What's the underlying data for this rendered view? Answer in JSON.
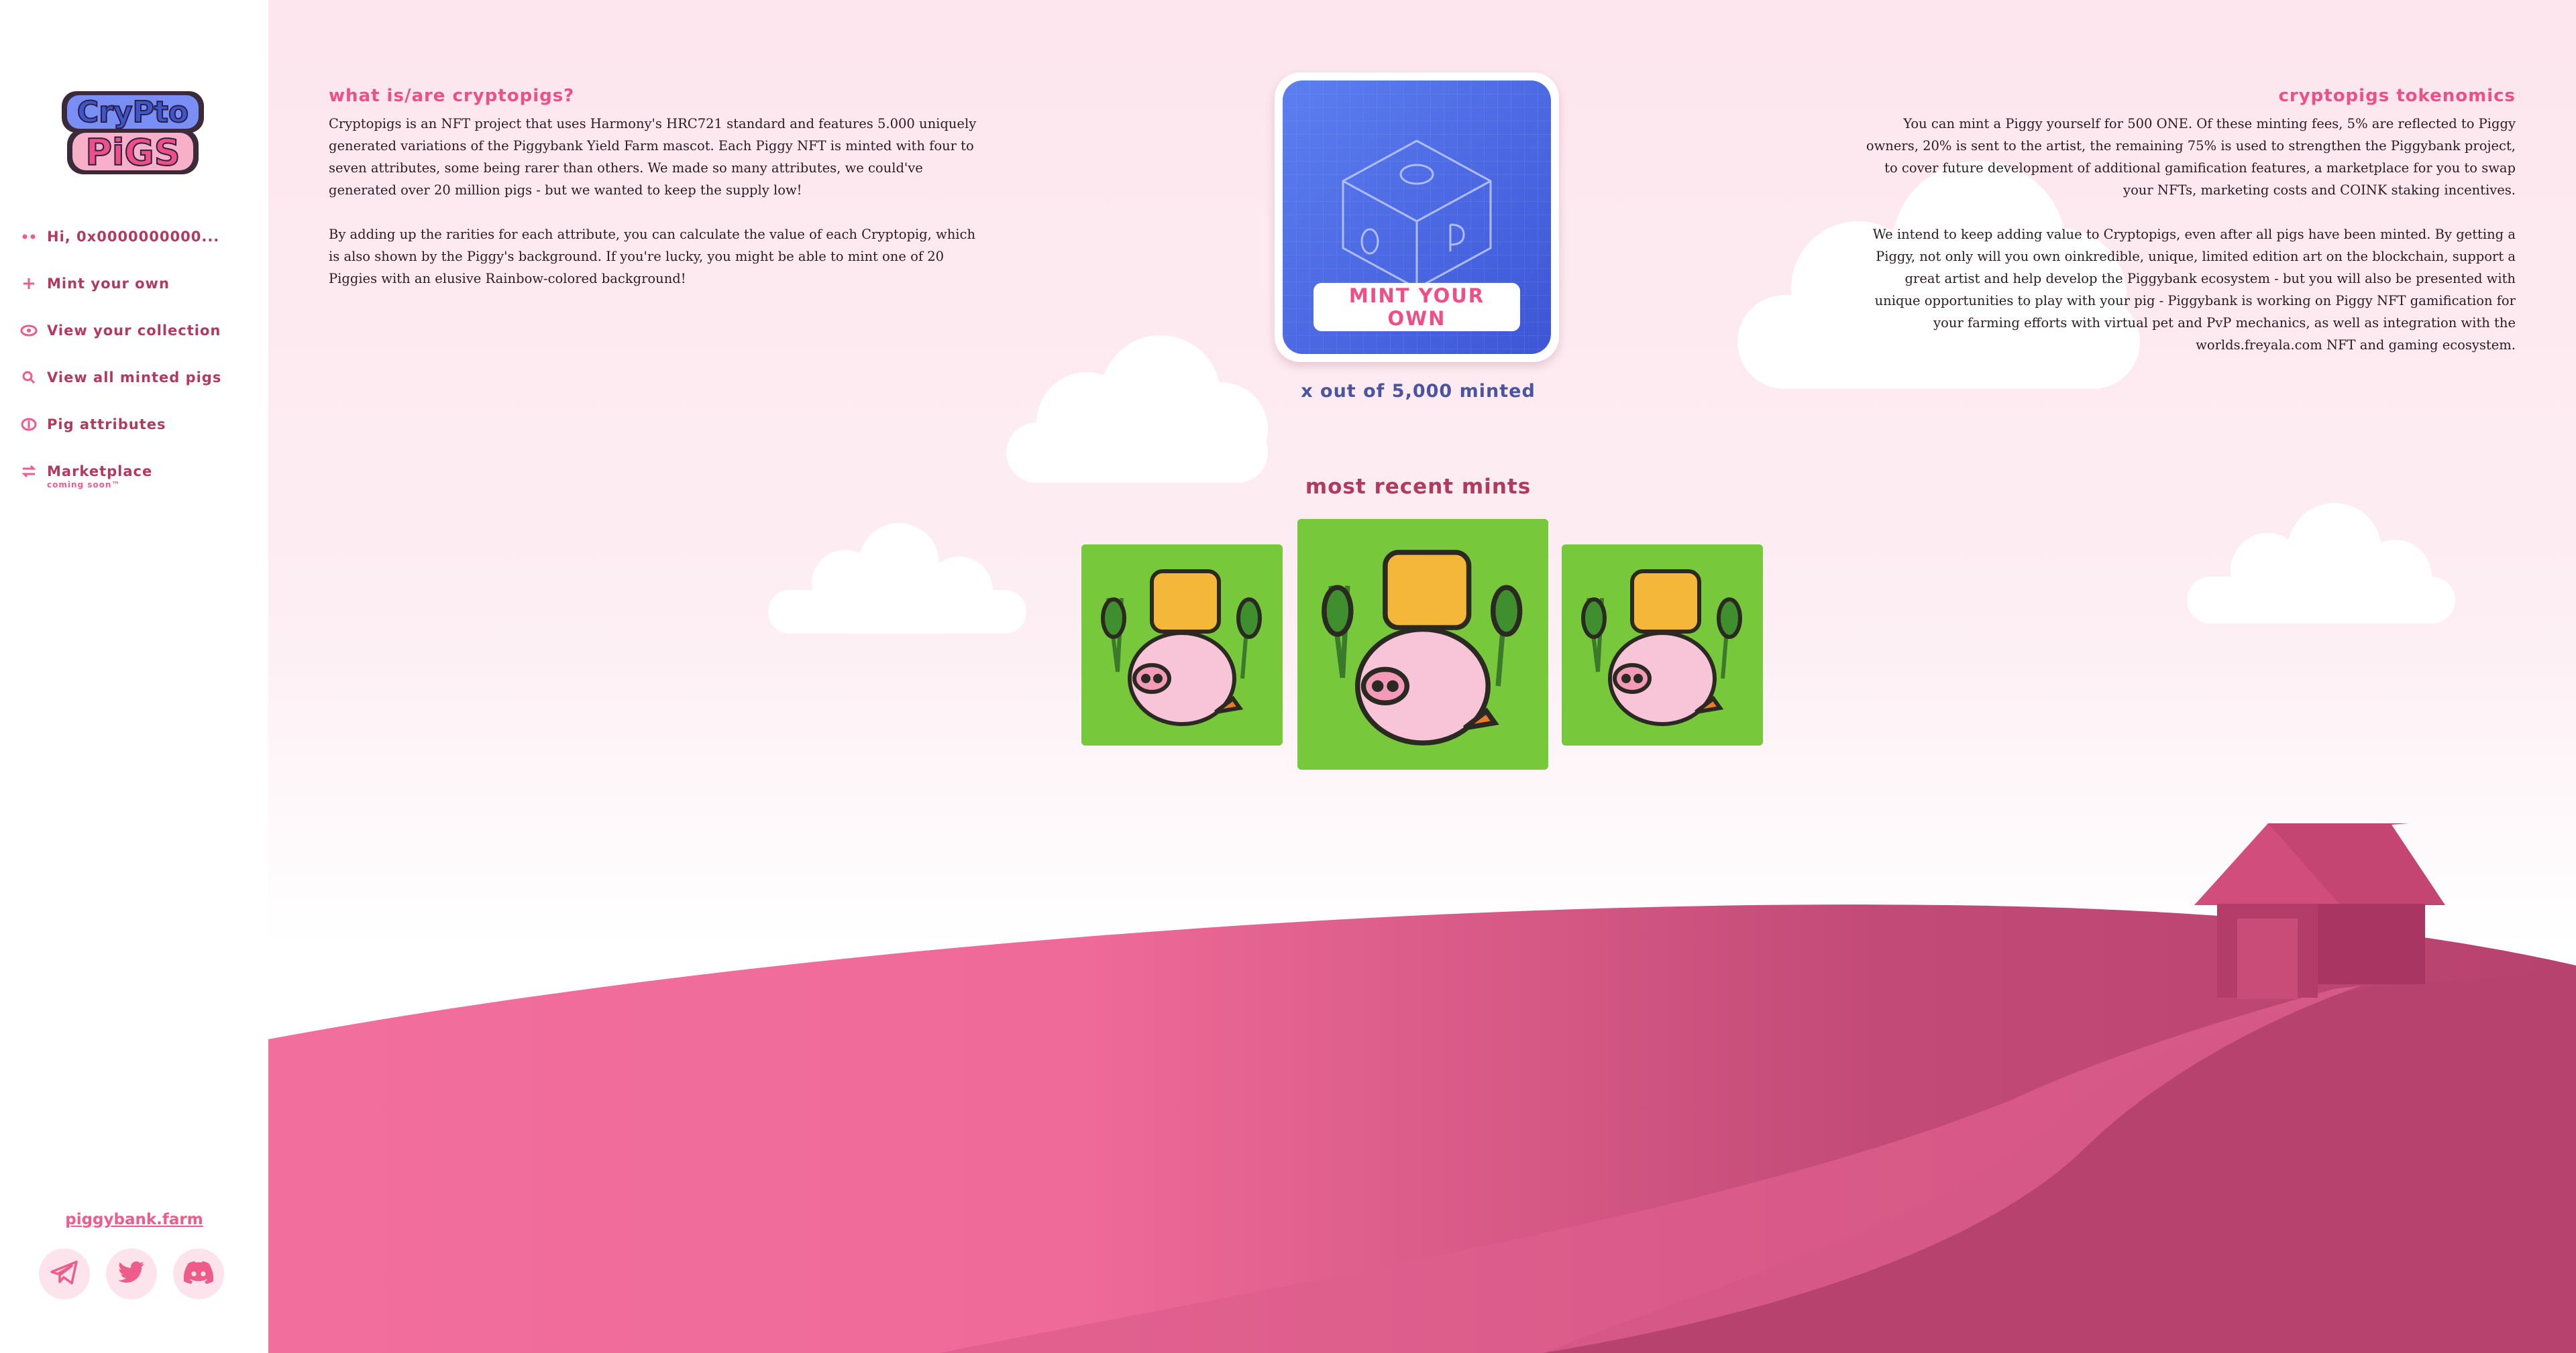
{
  "sidebar": {
    "logo_text": [
      "CryPto",
      "PiGS"
    ],
    "nav": [
      {
        "label": "Hi, 0x0000000000...",
        "icon": "dots-icon"
      },
      {
        "label": "Mint your own",
        "icon": "plus-icon"
      },
      {
        "label": "View your collection",
        "icon": "eye-icon"
      },
      {
        "label": "View all minted pigs",
        "icon": "search-icon"
      },
      {
        "label": "Pig attributes",
        "icon": "attributes-icon"
      },
      {
        "label": "Marketplace",
        "sub": "coming soon™",
        "icon": "swap-icon"
      }
    ],
    "footer_link": "piggybank.farm",
    "socials": [
      "telegram-icon",
      "twitter-icon",
      "discord-icon"
    ]
  },
  "about": {
    "title": "what is/are cryptopigs?",
    "p1": "Cryptopigs is an NFT project that uses Harmony's HRC721 standard and features 5.000 uniquely generated variations of the Piggybank Yield Farm mascot. Each Piggy NFT is minted with four to seven attributes, some being rarer than others. We made so many attributes, we could've generated over 20 million pigs - but we wanted to keep the supply low!",
    "p2": "By adding up the rarities for each attribute, you can calculate the value of each Cryptopig, which is also shown by the Piggy's background. If you're lucky, you might be able to mint one of 20 Piggies with an elusive Rainbow-colored background!"
  },
  "tokenomics": {
    "title": "cryptopigs tokenomics",
    "p1": "You can mint a Piggy yourself for 500 ONE. Of these minting fees, 5% are reflected to Piggy owners, 20% is sent to the artist, the remaining 75% is used to strengthen the Piggybank project, to cover future development of additional gamification features, a marketplace for you to swap your NFTs, marketing costs and COINK staking incentives.",
    "p2": "We intend to keep adding value to Cryptopigs, even after all pigs have been minted. By getting a Piggy, not only will you own oinkredible, unique, limited edition art on the blockchain, support a great artist and help develop the Piggybank ecosystem - but you will also be presented with unique opportunities to play with your pig - Piggybank is working on Piggy NFT gamification for your farming efforts with virtual pet and PvP mechanics, as well as integration with the worlds.freyala.com NFT and gaming ecosystem."
  },
  "mint": {
    "button_label": "MINT YOUR OWN",
    "minted_count": "x out of 5,000 minted"
  },
  "recent": {
    "title": "most recent mints"
  },
  "colors": {
    "accent": "#ee4f86",
    "nav_text": "#b23a5e",
    "hill_light": "#f26e9c",
    "hill_dark": "#b8426e",
    "card_green": "#78c83c"
  }
}
